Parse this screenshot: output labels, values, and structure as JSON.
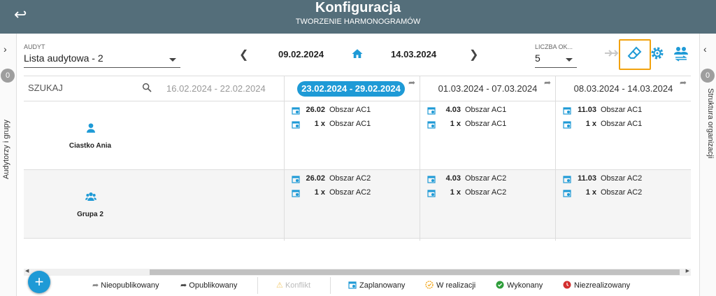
{
  "header": {
    "title": "Konfiguracja",
    "subtitle": "TWORZENIE HARMONOGRAMÓW",
    "back_icon": "back-arrow-icon"
  },
  "left_panel": {
    "badge": "0",
    "label": "Audytorzy i grupy"
  },
  "right_panel": {
    "badge": "0",
    "label": "Struktura organizacji"
  },
  "toolbar": {
    "audyt_label": "AUDYT",
    "audyt_value": "Lista audytowa - 2",
    "date_from": "09.02.2024",
    "date_to": "14.03.2024",
    "liczba_label": "LICZBA OK...",
    "liczba_value": "5"
  },
  "grid": {
    "search_placeholder": "SZUKAJ",
    "previous_week": "16.02.2024 - 22.02.2024",
    "weeks": [
      "23.02.2024 - 29.02.2024",
      "01.03.2024 - 07.03.2024",
      "08.03.2024 - 14.03.2024"
    ],
    "rows": [
      {
        "name": "Ciastko Ania",
        "icon": "person-icon",
        "cells": [
          [
            {
              "num": "26.02",
              "name": "Obszar AC1"
            },
            {
              "num": "1 x",
              "name": "Obszar AC1"
            }
          ],
          [
            {
              "num": "4.03",
              "name": "Obszar AC1"
            },
            {
              "num": "1 x",
              "name": "Obszar AC1"
            }
          ],
          [
            {
              "num": "11.03",
              "name": "Obszar AC1"
            },
            {
              "num": "1 x",
              "name": "Obszar AC1"
            }
          ]
        ]
      },
      {
        "name": "Grupa 2",
        "icon": "group-icon",
        "cells": [
          [
            {
              "num": "26.02",
              "name": "Obszar AC2"
            },
            {
              "num": "1 x",
              "name": "Obszar AC2"
            }
          ],
          [
            {
              "num": "4.03",
              "name": "Obszar AC2"
            },
            {
              "num": "1 x",
              "name": "Obszar AC2"
            }
          ],
          [
            {
              "num": "11.03",
              "name": "Obszar AC2"
            },
            {
              "num": "1 x",
              "name": "Obszar AC2"
            }
          ]
        ]
      }
    ]
  },
  "legend": {
    "nieopublikowany": "Nieopublikowany",
    "opublikowany": "Opublikowany",
    "konflikt": "Konflikt",
    "zaplanowany": "Zaplanowany",
    "w_realizacji": "W realizacji",
    "wykonany": "Wykonany",
    "niezrealizowany": "Niezrealizowany"
  },
  "colors": {
    "header": "#546e7a",
    "accent": "#1e9ad6",
    "highlight": "#f2a20e",
    "success": "#2e9d3a",
    "danger": "#d32f2f"
  }
}
